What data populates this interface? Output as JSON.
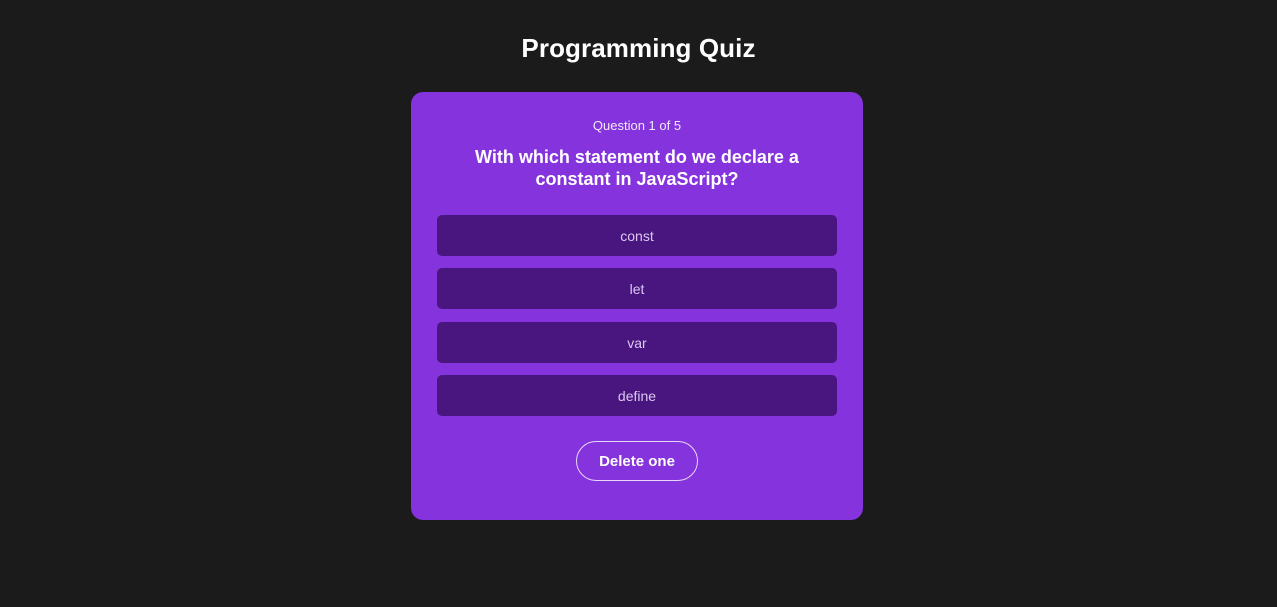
{
  "page": {
    "title": "Programming Quiz"
  },
  "quiz": {
    "counter": "Question 1 of 5",
    "question": "With which statement do we declare a constant in JavaScript?",
    "answers": [
      {
        "label": "const"
      },
      {
        "label": "let"
      },
      {
        "label": "var"
      },
      {
        "label": "define"
      }
    ],
    "delete_label": "Delete one"
  },
  "colors": {
    "background": "#1b1b1b",
    "card": "#8533dd",
    "answer_bg": "#49167f",
    "answer_text": "#dcc8f2",
    "text": "#ffffff"
  }
}
